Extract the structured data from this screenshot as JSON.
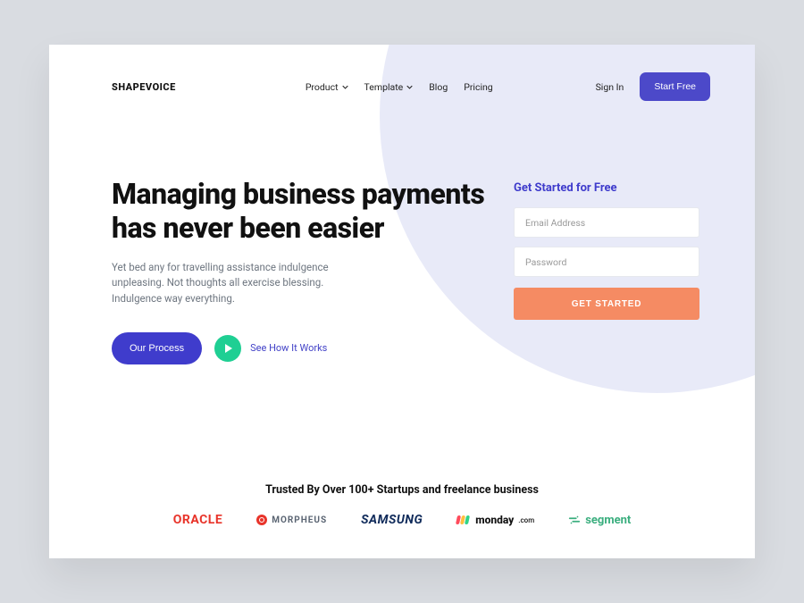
{
  "brand": "SHAPEVOICE",
  "nav": {
    "items": [
      {
        "label": "Product",
        "dropdown": true
      },
      {
        "label": "Template",
        "dropdown": true
      },
      {
        "label": "Blog",
        "dropdown": false
      },
      {
        "label": "Pricing",
        "dropdown": false
      }
    ],
    "sign_in": "Sign In",
    "cta": "Start Free"
  },
  "hero": {
    "headline": "Managing business payments has never been easier",
    "sub": "Yet bed any for travelling assistance indulgence unpleasing. Not thoughts all exercise blessing. Indulgence way everything.",
    "primary_btn": "Our Process",
    "play_label": "See How It Works"
  },
  "form": {
    "title": "Get Started for Free",
    "email_placeholder": "Email Address",
    "password_placeholder": "Password",
    "submit": "GET STARTED"
  },
  "trust": {
    "title": "Trusted By Over 100+ Startups and freelance business",
    "logos": {
      "oracle": "ORACLE",
      "morpheus": "MORPHEUS",
      "samsung": "SAMSUNG",
      "monday": "monday",
      "monday_suffix": ".com",
      "segment": "segment"
    }
  },
  "colors": {
    "primary": "#4c49c9",
    "accent": "#f58b63",
    "play": "#1fcf93"
  }
}
